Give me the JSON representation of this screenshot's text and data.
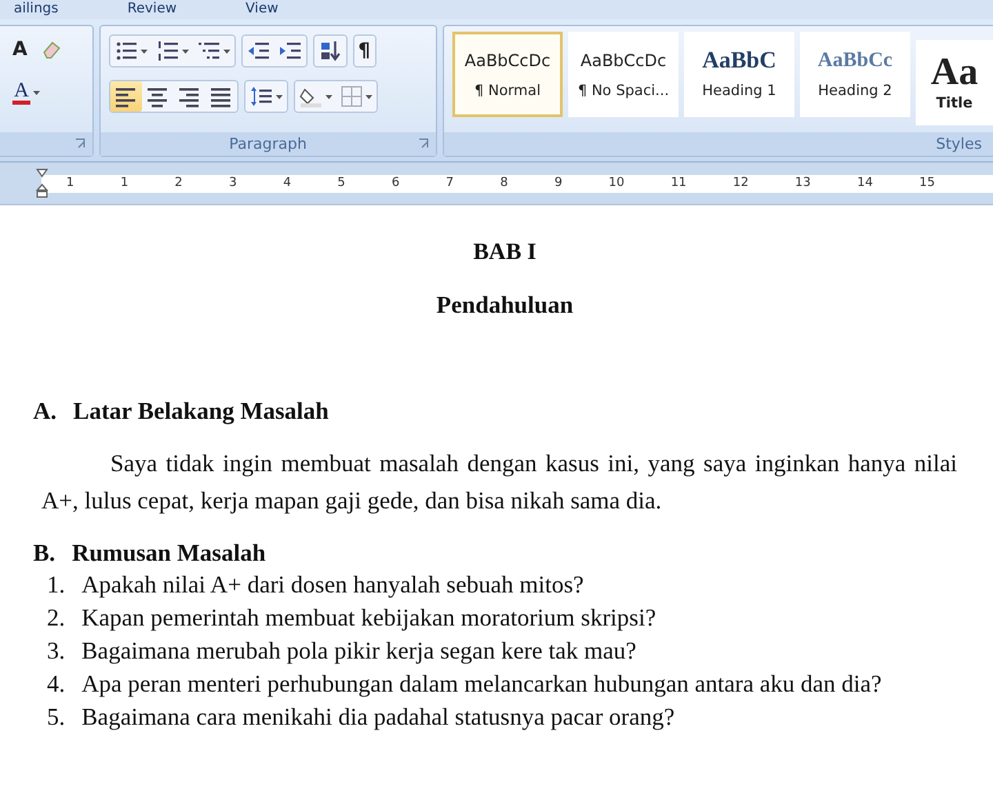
{
  "menu_tabs": [
    {
      "label": "ailings"
    },
    {
      "label": "Review"
    },
    {
      "label": "View"
    }
  ],
  "font_group": {
    "grow_font": "A",
    "font_color": "A"
  },
  "paragraph_group": {
    "label": "Paragraph",
    "list_buttons": [
      {
        "kind": "bullets"
      },
      {
        "kind": "numbering"
      },
      {
        "kind": "multilevel"
      }
    ],
    "indent_buttons": [
      {
        "kind": "decrease"
      },
      {
        "kind": "increase"
      }
    ],
    "show_marks": "¶",
    "alignment": [
      {
        "kind": "left",
        "selected": true
      },
      {
        "kind": "center",
        "selected": false
      },
      {
        "kind": "right",
        "selected": false
      },
      {
        "kind": "justify",
        "selected": false
      }
    ]
  },
  "styles_group": {
    "label": "Styles",
    "items": [
      {
        "kind": "normal",
        "preview": "AaBbCcDc",
        "name": "¶ Normal",
        "selected": true
      },
      {
        "kind": "nospacing",
        "preview": "AaBbCcDc",
        "name": "¶ No Spaci...",
        "selected": false
      },
      {
        "kind": "heading1",
        "preview": "AaBbC",
        "name": "Heading 1",
        "selected": false
      },
      {
        "kind": "heading2",
        "preview": "AaBbCc",
        "name": "Heading 2",
        "selected": false
      },
      {
        "kind": "title",
        "preview": "Aa",
        "name": "Title",
        "selected": false
      }
    ]
  },
  "ruler": [
    "1",
    "1",
    "2",
    "3",
    "4",
    "5",
    "6",
    "7",
    "8",
    "9",
    "10",
    "11",
    "12",
    "13",
    "14",
    "15"
  ],
  "document": {
    "title": "BAB I",
    "subtitle": "Pendahuluan",
    "sections": [
      {
        "heading_number": "A.",
        "heading": "Latar Belakang Masalah",
        "paragraph": "Saya tidak ingin membuat masalah dengan kasus ini, yang saya inginkan hanya nilai A+, lulus cepat, kerja mapan gaji gede, dan bisa nikah sama dia."
      },
      {
        "heading_number": "B.",
        "heading": "Rumusan Masalah",
        "items": [
          {
            "number": "1.",
            "text": "Apakah nilai A+ dari dosen hanyalah sebuah mitos?"
          },
          {
            "number": "2.",
            "text": "Kapan pemerintah membuat kebijakan moratorium skripsi?"
          },
          {
            "number": "3.",
            "text": "Bagaimana merubah pola pikir kerja segan kere tak mau?"
          },
          {
            "number": "4.",
            "text": "Apa peran menteri perhubungan dalam melancarkan hubungan antara aku dan dia?"
          },
          {
            "number": "5.",
            "text": "Bagaimana cara menikahi dia padahal statusnya pacar orang?"
          }
        ]
      }
    ]
  }
}
